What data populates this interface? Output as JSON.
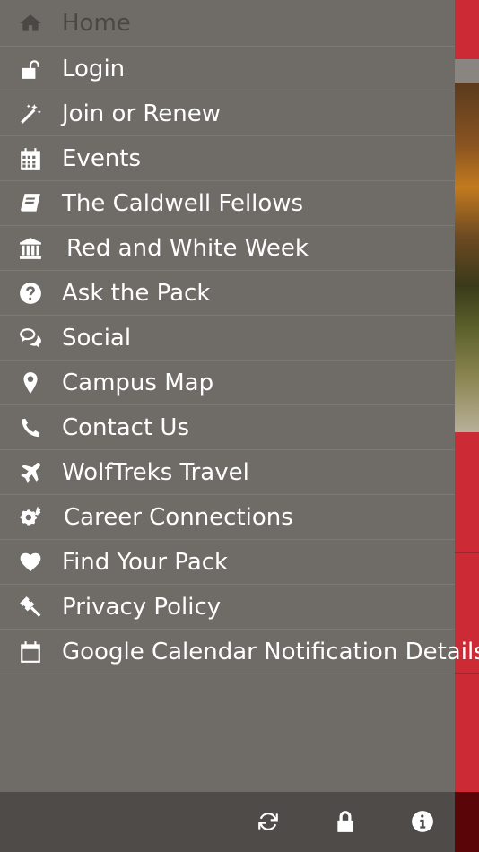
{
  "colors": {
    "drawer_bg": "#6f6b66",
    "toolbar_bg": "#4e4b48",
    "accent": "#cc2a35",
    "text": "#ffffff"
  },
  "menu": {
    "items": [
      {
        "label": "Home",
        "icon": "home-icon",
        "state": "disabled"
      },
      {
        "label": "Login",
        "icon": "unlock-icon"
      },
      {
        "label": "Join or Renew",
        "icon": "magic-wand-icon"
      },
      {
        "label": "Events",
        "icon": "calendar-grid-icon"
      },
      {
        "label": "The Caldwell Fellows",
        "icon": "book-icon"
      },
      {
        "label": "Red and White Week",
        "icon": "institution-icon"
      },
      {
        "label": "Ask the Pack",
        "icon": "question-circle-icon"
      },
      {
        "label": "Social",
        "icon": "chat-bubbles-icon"
      },
      {
        "label": "Campus Map",
        "icon": "map-pin-icon"
      },
      {
        "label": "Contact Us",
        "icon": "phone-icon"
      },
      {
        "label": "WolfTreks Travel",
        "icon": "airplane-icon"
      },
      {
        "label": "Career Connections",
        "icon": "gears-icon"
      },
      {
        "label": "Find Your Pack",
        "icon": "heart-icon"
      },
      {
        "label": "Privacy Policy",
        "icon": "gavel-icon"
      },
      {
        "label": "Google Calendar Notification Details",
        "icon": "calendar-icon"
      }
    ]
  },
  "toolbar": {
    "buttons": [
      {
        "icon": "refresh-icon"
      },
      {
        "icon": "lock-icon"
      },
      {
        "icon": "info-icon"
      }
    ]
  }
}
